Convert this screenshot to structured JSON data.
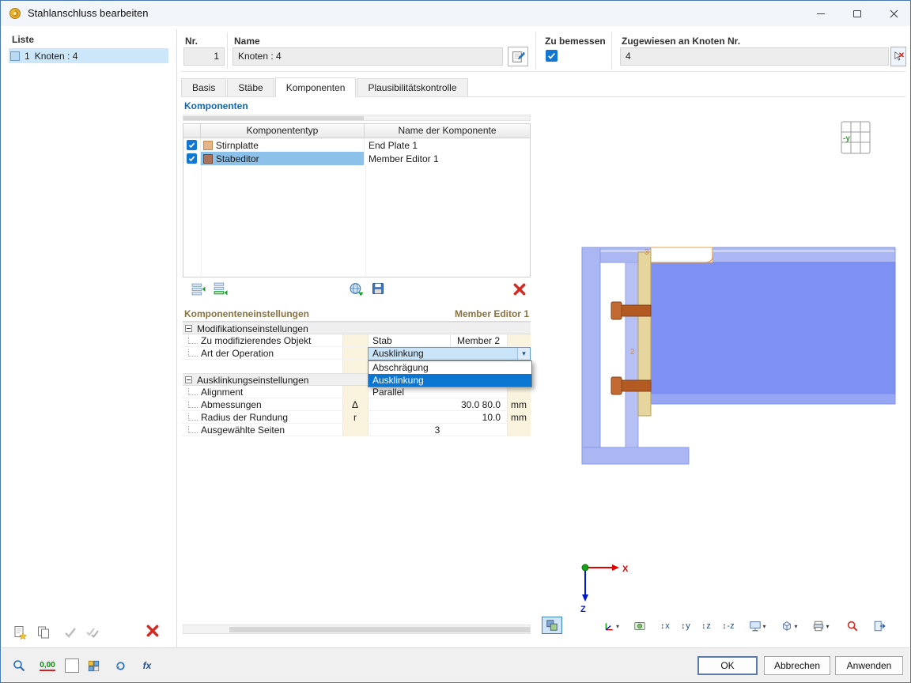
{
  "window": {
    "title": "Stahlanschluss bearbeiten"
  },
  "liste": {
    "label": "Liste",
    "item": {
      "index": "1",
      "label": "Knoten : 4"
    }
  },
  "header": {
    "nr_label": "Nr.",
    "nr_value": "1",
    "name_label": "Name",
    "name_value": "Knoten : 4",
    "zu_bemessen_label": "Zu bemessen",
    "zugewiesen_label": "Zugewiesen an Knoten Nr.",
    "zugewiesen_value": "4"
  },
  "tabs": {
    "basis": "Basis",
    "staebe": "Stäbe",
    "komponenten": "Komponenten",
    "plausi": "Plausibilitätskontrolle"
  },
  "components": {
    "title": "Komponenten",
    "col_type": "Komponententyp",
    "col_name": "Name der Komponente",
    "rows": [
      {
        "type": "Stirnplatte",
        "name": "End Plate 1"
      },
      {
        "type": "Stabeditor",
        "name": "Member Editor 1"
      }
    ]
  },
  "settings": {
    "title": "Komponenteneinstellungen",
    "editor": "Member Editor 1",
    "group1_label": "Modifikationseinstellungen",
    "row_object_label": "Zu modifizierendes Objekt",
    "row_object_value": "Stab",
    "row_object_value2": "Member 2",
    "row_operation_label": "Art der Operation",
    "row_operation_value": "Ausklinkung",
    "dropdown": {
      "option1": "Abschrägung",
      "option2": "Ausklinkung"
    },
    "group2_label": "Ausklinkungseinstellungen",
    "row_alignment_label": "Alignment",
    "row_alignment_value": "Parallel",
    "row_dim_label": "Abmessungen",
    "row_dim_symbol": "Δ",
    "row_dim_value": "30.0 80.0",
    "row_dim_unit": "mm",
    "row_radius_label": "Radius der Rundung",
    "row_radius_symbol": "r",
    "row_radius_value": "10.0",
    "row_radius_unit": "mm",
    "row_sides_label": "Ausgewählte Seiten",
    "row_sides_value": "3"
  },
  "viewport": {
    "orientation": "-y",
    "axis_x": "X",
    "axis_z": "Z",
    "label_bolt": "2",
    "label_notch": "3",
    "toolbar_axes": {
      "x": "x",
      "y": "y",
      "z": "z",
      "minus_z": "-z"
    }
  },
  "icons": {
    "chevron_down": "▾",
    "updown": "↕"
  },
  "statusbar": {
    "decimal": "0,00",
    "fx": "fx"
  },
  "footer": {
    "ok": "OK",
    "cancel": "Abbrechen",
    "apply": "Anwenden"
  },
  "colors": {
    "accent_blue": "#0b76d1",
    "selection_light": "#8cc2ea",
    "beam_blue": "#7e91f3",
    "member_light": "#aab7f3",
    "plate_tan": "#e7d59e",
    "bolt_orange": "#c26a32",
    "danger_red": "#d6281e"
  }
}
